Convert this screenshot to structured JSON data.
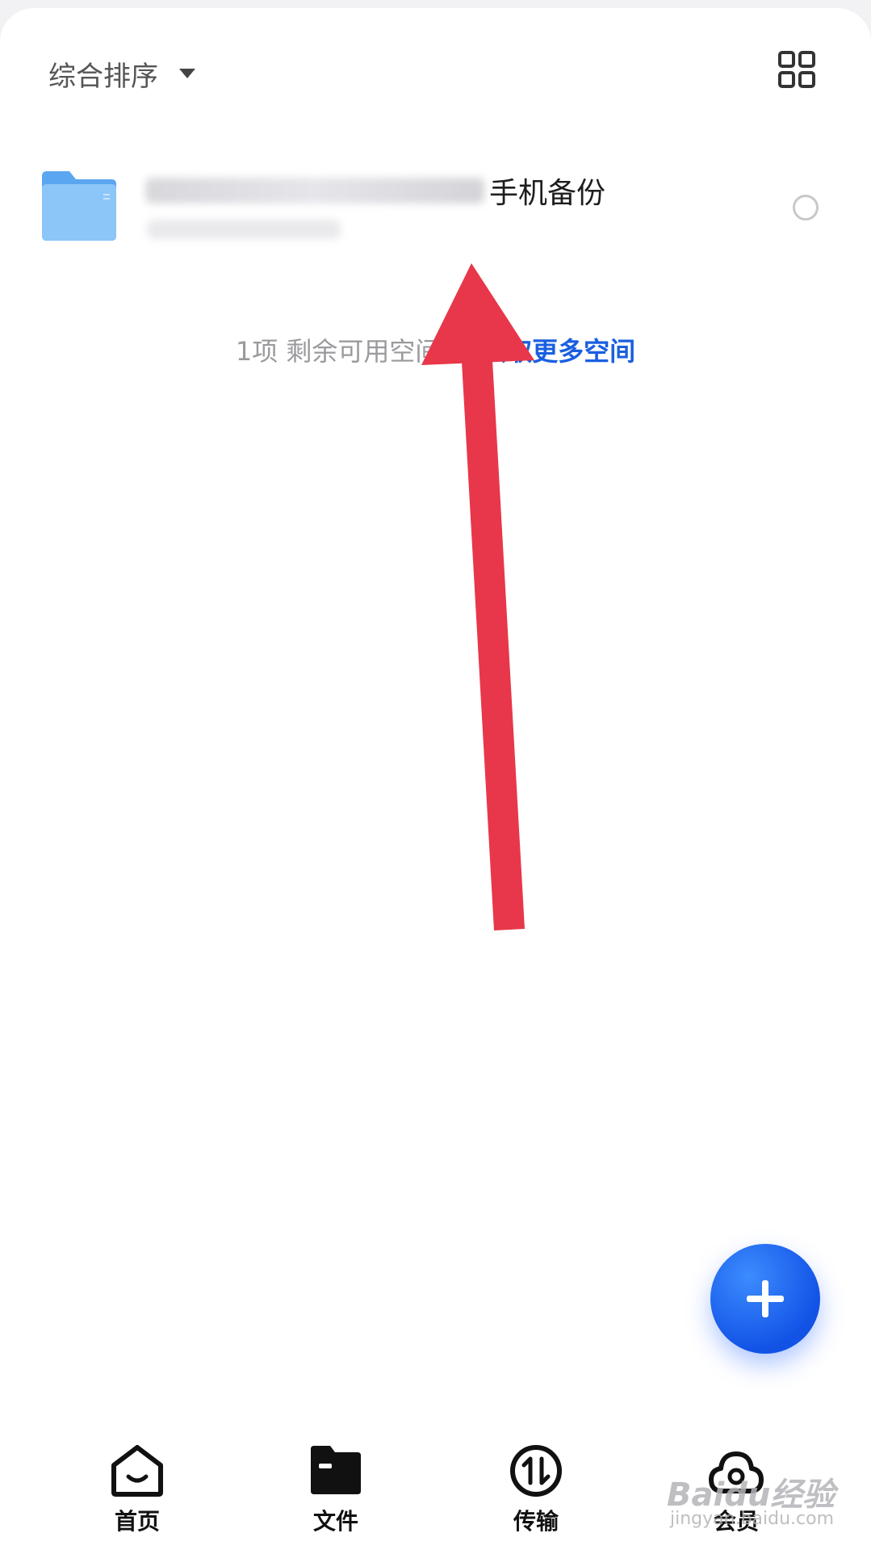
{
  "toolbar": {
    "sort_label": "综合排序",
    "caret_icon": "caret-down-icon",
    "view_toggle_icon": "grid-view-icon"
  },
  "file_list": {
    "items": [
      {
        "icon": "folder-icon",
        "title_visible_suffix": "手机备份",
        "selected": false
      }
    ]
  },
  "storage": {
    "count_text": "1项 剩余可用空间9.",
    "get_more_link": "获取更多空间",
    "link_color": "#1a5fe0"
  },
  "fab": {
    "icon": "plus-icon",
    "color": "#1f63ff"
  },
  "annotation": {
    "arrow_color": "#e8374a"
  },
  "bottom_nav": {
    "items": [
      {
        "label": "首页",
        "icon": "home-icon"
      },
      {
        "label": "文件",
        "icon": "folder-filled-icon",
        "active": true
      },
      {
        "label": "传输",
        "icon": "transfer-icon"
      },
      {
        "label": "会员",
        "icon": "cloud-member-icon"
      }
    ]
  },
  "watermark": {
    "text": "Baidu经验",
    "sub": "jingyan.baidu.com"
  }
}
